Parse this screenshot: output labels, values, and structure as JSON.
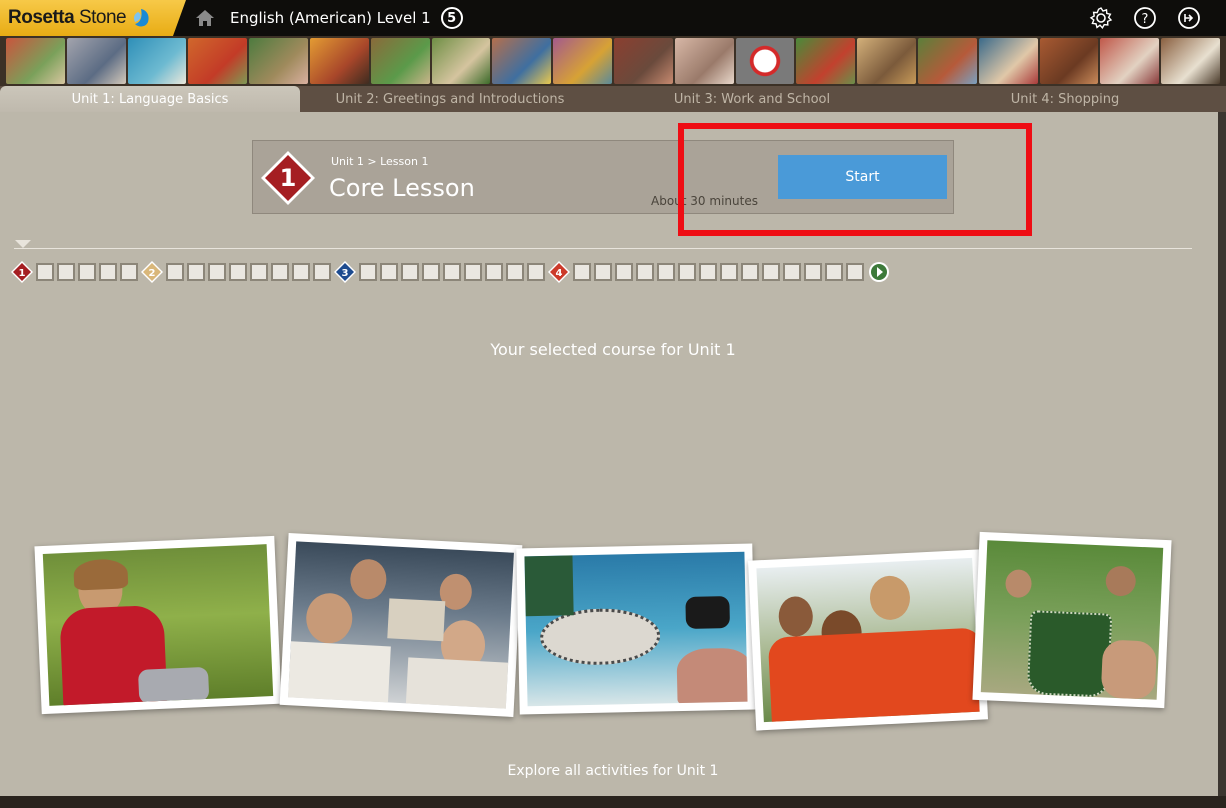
{
  "topbar": {
    "logo_text_bold": "Rosetta",
    "logo_text": " Stone",
    "course_title": "English (American) Level 1",
    "level_number": "5",
    "icons": [
      "home-icon",
      "settings-gear-icon",
      "help-icon",
      "exit-icon"
    ]
  },
  "unit_tabs": [
    {
      "label": "Unit 1: Language Basics"
    },
    {
      "label": "Unit 2: Greetings and Introductions"
    },
    {
      "label": "Unit 3: Work and School"
    },
    {
      "label": "Unit 4: Shopping"
    }
  ],
  "lesson": {
    "number": "1",
    "breadcrumb": "Unit 1 > Lesson 1",
    "title": "Core Lesson",
    "duration": "About 30 minutes",
    "start_label": "Start"
  },
  "track": {
    "lesson_markers": [
      "1",
      "2",
      "3",
      "4"
    ],
    "marker_colors": [
      "#a51e22",
      "#d9b77a",
      "#1d4b8f",
      "#cc3a2a"
    ],
    "boxes_after_markers": [
      5,
      8,
      9,
      14
    ]
  },
  "captions": {
    "selected": "Your selected course for Unit 1",
    "explore": "Explore all activities for Unit 1"
  },
  "colors": {
    "accent_start": "#4a9ad8",
    "highlight": "#ee0d14",
    "logo_yellow": "#f2bd2f"
  }
}
